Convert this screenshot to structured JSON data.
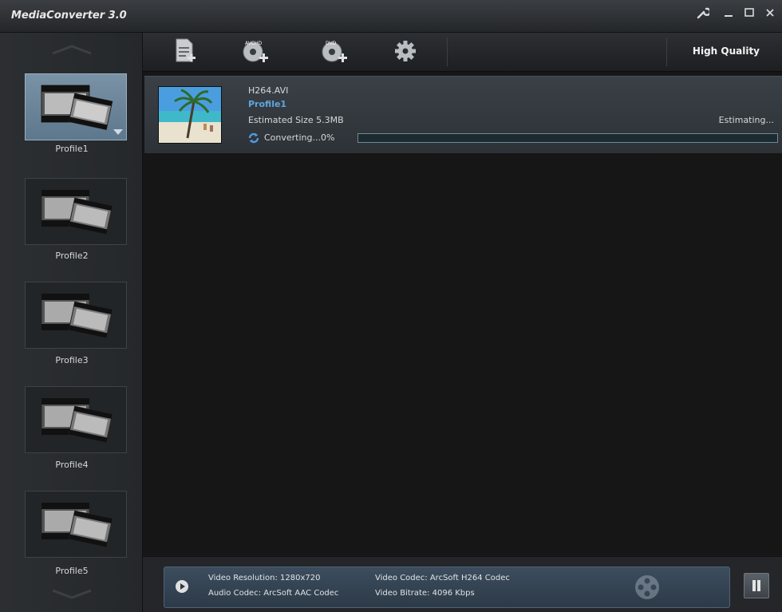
{
  "window": {
    "title": "MediaConverter 3.0",
    "controls": [
      "wrench-icon",
      "minimize-icon",
      "maximize-icon",
      "close-icon"
    ]
  },
  "sidebar": {
    "profiles": [
      {
        "label": "Profile1",
        "selected": true
      },
      {
        "label": "Profile2",
        "selected": false
      },
      {
        "label": "Profile3",
        "selected": false
      },
      {
        "label": "Profile4",
        "selected": false
      },
      {
        "label": "Profile5",
        "selected": false
      }
    ]
  },
  "toolbar": {
    "tools": [
      "add-file-icon",
      "add-avchd-icon",
      "add-dvd-icon",
      "settings-gear-icon"
    ],
    "quality_label": "High Quality"
  },
  "task": {
    "filename": "H264.AVI",
    "profile": "Profile1",
    "estimated_size": "Estimated Size 5.3MB",
    "status": "Converting...0%",
    "estimate_label": "Estimating...",
    "progress_percent": 0
  },
  "info": {
    "video_resolution": "Video Resolution: 1280x720",
    "audio_codec": "Audio Codec: ArcSoft AAC Codec",
    "video_codec": "Video Codec: ArcSoft H264 Codec",
    "video_bitrate": "Video Bitrate: 4096 Kbps"
  },
  "colors": {
    "accent_blue": "#5fa6e0",
    "selected_profile": "#6c859a",
    "info_panel": "#34465a"
  }
}
